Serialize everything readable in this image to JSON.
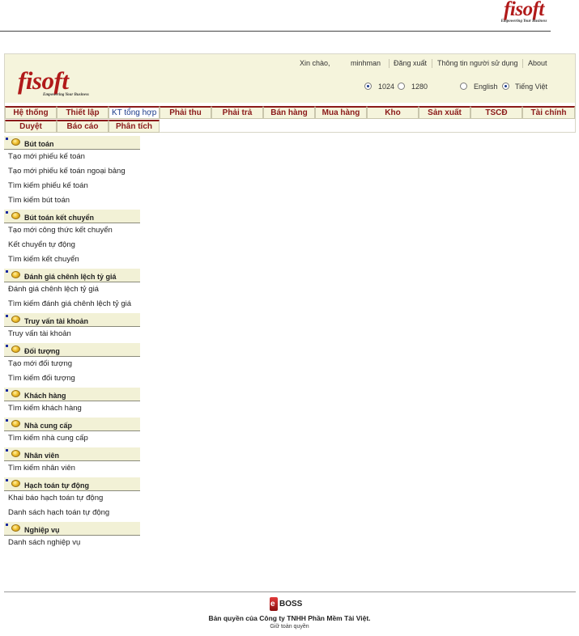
{
  "doc_logo": {
    "brand": "fisoft",
    "tagline": "Empowering Your Business"
  },
  "header": {
    "brand": "fisoft",
    "tagline": "Empowering Your Business",
    "greeting": "Xin chào,",
    "username": "minhman",
    "logout": "Đăng xuất",
    "user_info": "Thông tin người sử dụng",
    "about": "About",
    "resolution_options": [
      {
        "label": "1024",
        "selected": true
      },
      {
        "label": "1280",
        "selected": false
      }
    ],
    "language_options": [
      {
        "label": "English",
        "selected": false
      },
      {
        "label": "Tiếng Việt",
        "selected": true
      }
    ]
  },
  "menu": {
    "row1": [
      "Hệ thống",
      "Thiết lập",
      "KT tổng hợp",
      "Phải thu",
      "Phải trả",
      "Bán hàng",
      "Mua hàng",
      "Kho",
      "Sản xuất",
      "TSCĐ",
      "Tài chính"
    ],
    "row2": [
      "Duyệt",
      "Báo cáo",
      "Phân tích"
    ],
    "active": "KT tổng hợp"
  },
  "leftnav": [
    {
      "title": "Bút toán",
      "links": [
        "Tạo mới phiếu kế toán",
        "Tạo mới phiếu kế toán ngoại bảng",
        "Tìm kiếm phiếu kế toán",
        "Tìm kiếm bút toán"
      ]
    },
    {
      "title": "Bút toán kết chuyển",
      "links": [
        "Tạo mới công thức kết chuyển",
        "Kết chuyển tự động",
        "Tìm kiếm kết chuyển"
      ]
    },
    {
      "title": "Đánh giá chênh lệch tỷ giá",
      "links": [
        "Đánh giá chênh lệch tỷ giá",
        "Tìm kiếm đánh giá chênh lệch tỷ giá"
      ]
    },
    {
      "title": "Truy vấn tài khoản",
      "links": [
        "Truy vấn tài khoản"
      ]
    },
    {
      "title": "Đối tượng",
      "links": [
        "Tạo mới đối tượng",
        "Tìm kiếm đối tượng"
      ]
    },
    {
      "title": "Khách hàng",
      "links": [
        "Tìm kiếm khách hàng"
      ]
    },
    {
      "title": "Nhà cung cấp",
      "links": [
        "Tìm kiếm nhà cung cấp"
      ]
    },
    {
      "title": "Nhân viên",
      "links": [
        "Tìm kiếm nhân viên"
      ]
    },
    {
      "title": "Hạch toán tự động",
      "links": [
        "Khai báo hạch toán tự động",
        "Danh sách hạch toán tự động"
      ]
    },
    {
      "title": "Nghiệp vụ",
      "links": [
        "Danh sách nghiệp vụ"
      ]
    }
  ],
  "footer": {
    "logo_letter": "e",
    "logo_word": "BOSS",
    "copyright": "Bản quyền của Công ty TNHH Phần Mềm Tài Việt.",
    "rights": "Giữ toàn quyền"
  },
  "colors": {
    "brand_red": "#b11a1a",
    "menu_border": "#8b1a1a",
    "header_bg": "#f5f4dc",
    "link_blue": "#1a3a8a"
  }
}
